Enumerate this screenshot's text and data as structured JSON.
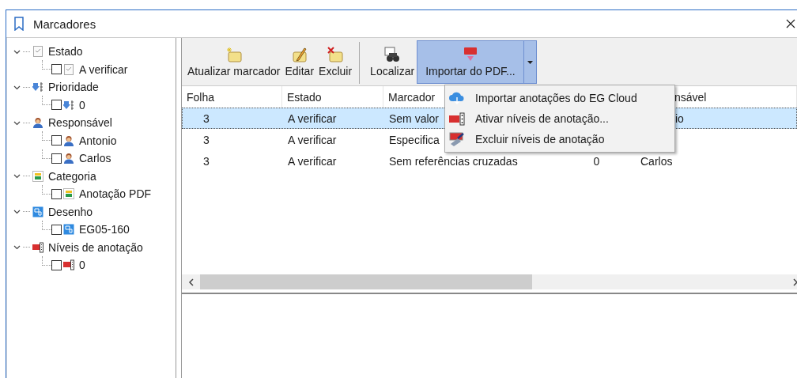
{
  "window": {
    "title": "Marcadores"
  },
  "tree": [
    {
      "label": "Estado",
      "kind": "status",
      "expanded": true,
      "children": [
        {
          "label": "A verificar",
          "checked": false
        }
      ]
    },
    {
      "label": "Prioridade",
      "kind": "priority",
      "expanded": true,
      "children": [
        {
          "label": "0",
          "checked": false
        }
      ]
    },
    {
      "label": "Responsável",
      "kind": "person",
      "expanded": true,
      "children": [
        {
          "label": "Antonio",
          "checked": false
        },
        {
          "label": "Carlos",
          "checked": false
        }
      ]
    },
    {
      "label": "Categoria",
      "kind": "category",
      "expanded": true,
      "children": [
        {
          "label": "Anotação PDF",
          "checked": false
        }
      ]
    },
    {
      "label": "Desenho",
      "kind": "drawing",
      "expanded": true,
      "children": [
        {
          "label": "EG05-160",
          "checked": false
        }
      ]
    },
    {
      "label": "Níveis de anotação",
      "kind": "levels",
      "expanded": true,
      "children": [
        {
          "label": "0",
          "checked": false
        }
      ]
    }
  ],
  "toolbar": [
    {
      "label": "Atualizar marcador",
      "kind": "new",
      "selected": false
    },
    {
      "label": "Editar",
      "kind": "edit",
      "selected": false
    },
    {
      "label": "Excluir",
      "kind": "delete",
      "selected": false
    },
    {
      "label": "Localizar",
      "kind": "find",
      "selected": false,
      "separator_before": true
    },
    {
      "label": "Importar do PDF...",
      "kind": "pdf",
      "selected": true,
      "dropdown": true
    }
  ],
  "table": {
    "columns": [
      "Folha",
      "Estado",
      "Marcador",
      null,
      {
        "text": "nsável",
        "cut": true
      }
    ],
    "rows": [
      {
        "selected": true,
        "cells": [
          "3",
          "A verificar",
          "Sem valor",
          null,
          {
            "text": "io",
            "cut": true
          }
        ]
      },
      {
        "selected": false,
        "cells": [
          "3",
          "A verificar",
          "Especifica",
          null,
          null
        ]
      },
      {
        "selected": false,
        "cells": [
          "3",
          "A verificar",
          "Sem referências cruzadas",
          "0",
          "Carlos"
        ]
      }
    ]
  },
  "dropdown_menu": [
    {
      "label": "Importar anotações do EG Cloud",
      "kind": "cloud"
    },
    {
      "label": "Ativar níveis de anotação...",
      "kind": "levels"
    },
    {
      "label": "Excluir níveis de anotação",
      "kind": "delete-levels"
    }
  ]
}
